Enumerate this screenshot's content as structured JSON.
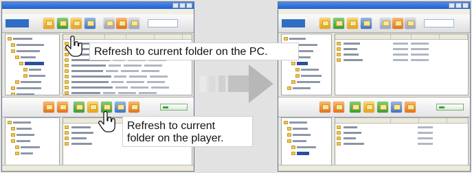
{
  "callouts": {
    "pc_refresh": "Refresh to current folder on the PC.",
    "player_refresh_line1": "Refresh to current",
    "player_refresh_line2": "folder on the player."
  },
  "colors": {
    "titlebar": "#2f6fd6",
    "window_face": "#ece9d8",
    "background": "#e2e2e2",
    "arrow": "#b7b7b7"
  },
  "icons": [
    "hand-pointer-icon",
    "hand-pointer-icon",
    "right-arrow-icon"
  ]
}
